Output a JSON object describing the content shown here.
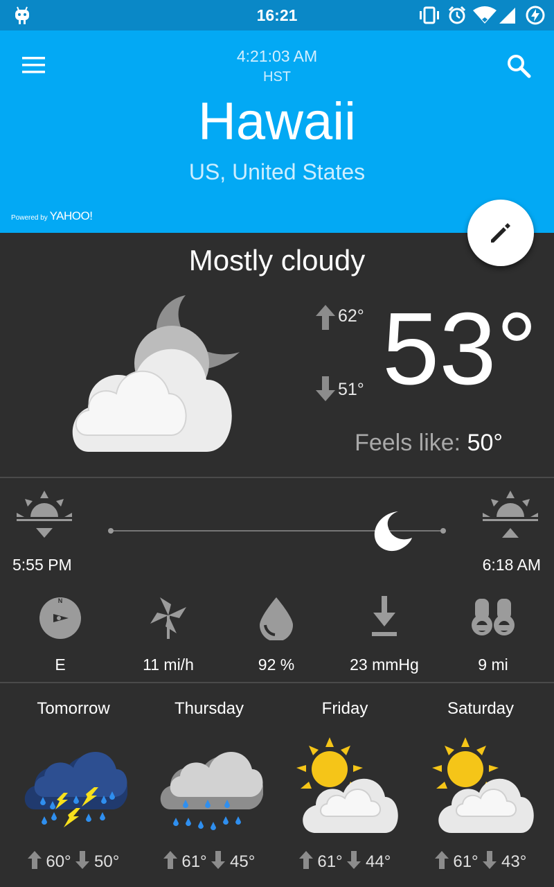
{
  "status_bar": {
    "time": "16:21",
    "icons": [
      "cyanogen-icon",
      "vibrate-icon",
      "alarm-icon",
      "wifi-icon",
      "signal-icon",
      "battery-charging-icon"
    ]
  },
  "header": {
    "clock": "4:21:03 AM",
    "timezone": "HST",
    "city": "Hawaii",
    "country": "US, United States",
    "powered_prefix": "Powered by",
    "powered_brand": "YAHOO!",
    "accent_color": "#03a9f4"
  },
  "current": {
    "condition": "Mostly cloudy",
    "icon": "mostly-cloudy-night-icon",
    "high": "62°",
    "low": "51°",
    "temperature": "53°",
    "feels_like_label": "Feels like:",
    "feels_like_value": "50°"
  },
  "sun": {
    "sunset": "5:55 PM",
    "sunrise": "6:18 AM",
    "position_fraction": 0.85
  },
  "details": [
    {
      "icon": "compass-icon",
      "value": "E"
    },
    {
      "icon": "wind-icon",
      "value": "11 mi/h"
    },
    {
      "icon": "humidity-drop-icon",
      "value": "92 %"
    },
    {
      "icon": "pressure-icon",
      "value": "23 mmHg"
    },
    {
      "icon": "visibility-binoculars-icon",
      "value": "9 mi"
    }
  ],
  "forecast": [
    {
      "day": "Tomorrow",
      "icon": "thunderstorm-icon",
      "high": "60°",
      "low": "50°"
    },
    {
      "day": "Thursday",
      "icon": "rain-showers-icon",
      "high": "61°",
      "low": "45°"
    },
    {
      "day": "Friday",
      "icon": "partly-cloudy-day-icon",
      "high": "61°",
      "low": "44°"
    },
    {
      "day": "Saturday",
      "icon": "partly-cloudy-day-icon",
      "high": "61°",
      "low": "43°"
    }
  ]
}
